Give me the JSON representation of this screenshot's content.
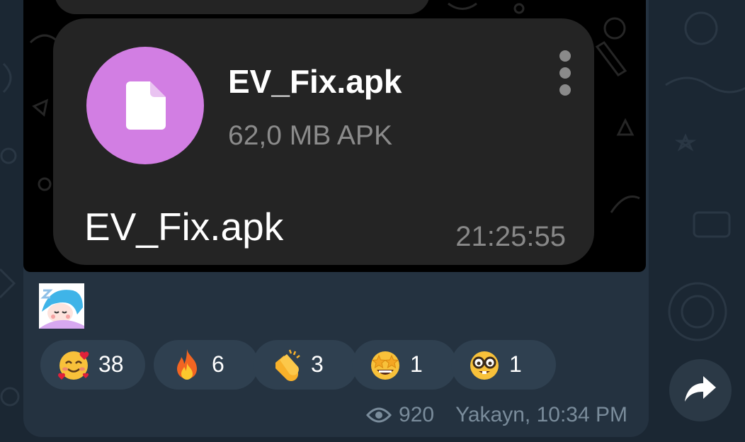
{
  "colors": {
    "background": "#1b2733",
    "card": "#243240",
    "bubble": "#242424",
    "file_icon": "#d27ee3",
    "chip": "#2f4050"
  },
  "file": {
    "icon": "file-icon",
    "name": "EV_Fix.apk",
    "size": "62,0 MB APK",
    "caption": "EV_Fix.apk",
    "time": "21:25:55"
  },
  "sticker": {
    "icon": "sleeping-girl-sticker"
  },
  "reactions": [
    {
      "emoji": "smiling-face-with-hearts",
      "count": "38"
    },
    {
      "emoji": "fire",
      "count": "6"
    },
    {
      "emoji": "clapping-hands",
      "count": "3"
    },
    {
      "emoji": "star-struck",
      "count": "1"
    },
    {
      "emoji": "nerd-face",
      "count": "1"
    }
  ],
  "meta": {
    "views_icon": "eye-icon",
    "views": "920",
    "author_time": "Yakayn, 10:34 PM"
  },
  "share": {
    "icon": "share-arrow-icon"
  }
}
